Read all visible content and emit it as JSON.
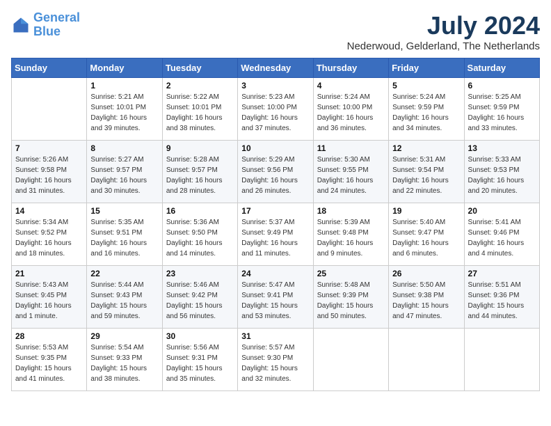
{
  "header": {
    "logo_line1": "General",
    "logo_line2": "Blue",
    "month_year": "July 2024",
    "location": "Nederwoud, Gelderland, The Netherlands"
  },
  "days_of_week": [
    "Sunday",
    "Monday",
    "Tuesday",
    "Wednesday",
    "Thursday",
    "Friday",
    "Saturday"
  ],
  "weeks": [
    [
      {
        "day": "",
        "info": ""
      },
      {
        "day": "1",
        "info": "Sunrise: 5:21 AM\nSunset: 10:01 PM\nDaylight: 16 hours\nand 39 minutes."
      },
      {
        "day": "2",
        "info": "Sunrise: 5:22 AM\nSunset: 10:01 PM\nDaylight: 16 hours\nand 38 minutes."
      },
      {
        "day": "3",
        "info": "Sunrise: 5:23 AM\nSunset: 10:00 PM\nDaylight: 16 hours\nand 37 minutes."
      },
      {
        "day": "4",
        "info": "Sunrise: 5:24 AM\nSunset: 10:00 PM\nDaylight: 16 hours\nand 36 minutes."
      },
      {
        "day": "5",
        "info": "Sunrise: 5:24 AM\nSunset: 9:59 PM\nDaylight: 16 hours\nand 34 minutes."
      },
      {
        "day": "6",
        "info": "Sunrise: 5:25 AM\nSunset: 9:59 PM\nDaylight: 16 hours\nand 33 minutes."
      }
    ],
    [
      {
        "day": "7",
        "info": "Sunrise: 5:26 AM\nSunset: 9:58 PM\nDaylight: 16 hours\nand 31 minutes."
      },
      {
        "day": "8",
        "info": "Sunrise: 5:27 AM\nSunset: 9:57 PM\nDaylight: 16 hours\nand 30 minutes."
      },
      {
        "day": "9",
        "info": "Sunrise: 5:28 AM\nSunset: 9:57 PM\nDaylight: 16 hours\nand 28 minutes."
      },
      {
        "day": "10",
        "info": "Sunrise: 5:29 AM\nSunset: 9:56 PM\nDaylight: 16 hours\nand 26 minutes."
      },
      {
        "day": "11",
        "info": "Sunrise: 5:30 AM\nSunset: 9:55 PM\nDaylight: 16 hours\nand 24 minutes."
      },
      {
        "day": "12",
        "info": "Sunrise: 5:31 AM\nSunset: 9:54 PM\nDaylight: 16 hours\nand 22 minutes."
      },
      {
        "day": "13",
        "info": "Sunrise: 5:33 AM\nSunset: 9:53 PM\nDaylight: 16 hours\nand 20 minutes."
      }
    ],
    [
      {
        "day": "14",
        "info": "Sunrise: 5:34 AM\nSunset: 9:52 PM\nDaylight: 16 hours\nand 18 minutes."
      },
      {
        "day": "15",
        "info": "Sunrise: 5:35 AM\nSunset: 9:51 PM\nDaylight: 16 hours\nand 16 minutes."
      },
      {
        "day": "16",
        "info": "Sunrise: 5:36 AM\nSunset: 9:50 PM\nDaylight: 16 hours\nand 14 minutes."
      },
      {
        "day": "17",
        "info": "Sunrise: 5:37 AM\nSunset: 9:49 PM\nDaylight: 16 hours\nand 11 minutes."
      },
      {
        "day": "18",
        "info": "Sunrise: 5:39 AM\nSunset: 9:48 PM\nDaylight: 16 hours\nand 9 minutes."
      },
      {
        "day": "19",
        "info": "Sunrise: 5:40 AM\nSunset: 9:47 PM\nDaylight: 16 hours\nand 6 minutes."
      },
      {
        "day": "20",
        "info": "Sunrise: 5:41 AM\nSunset: 9:46 PM\nDaylight: 16 hours\nand 4 minutes."
      }
    ],
    [
      {
        "day": "21",
        "info": "Sunrise: 5:43 AM\nSunset: 9:45 PM\nDaylight: 16 hours\nand 1 minute."
      },
      {
        "day": "22",
        "info": "Sunrise: 5:44 AM\nSunset: 9:43 PM\nDaylight: 15 hours\nand 59 minutes."
      },
      {
        "day": "23",
        "info": "Sunrise: 5:46 AM\nSunset: 9:42 PM\nDaylight: 15 hours\nand 56 minutes."
      },
      {
        "day": "24",
        "info": "Sunrise: 5:47 AM\nSunset: 9:41 PM\nDaylight: 15 hours\nand 53 minutes."
      },
      {
        "day": "25",
        "info": "Sunrise: 5:48 AM\nSunset: 9:39 PM\nDaylight: 15 hours\nand 50 minutes."
      },
      {
        "day": "26",
        "info": "Sunrise: 5:50 AM\nSunset: 9:38 PM\nDaylight: 15 hours\nand 47 minutes."
      },
      {
        "day": "27",
        "info": "Sunrise: 5:51 AM\nSunset: 9:36 PM\nDaylight: 15 hours\nand 44 minutes."
      }
    ],
    [
      {
        "day": "28",
        "info": "Sunrise: 5:53 AM\nSunset: 9:35 PM\nDaylight: 15 hours\nand 41 minutes."
      },
      {
        "day": "29",
        "info": "Sunrise: 5:54 AM\nSunset: 9:33 PM\nDaylight: 15 hours\nand 38 minutes."
      },
      {
        "day": "30",
        "info": "Sunrise: 5:56 AM\nSunset: 9:31 PM\nDaylight: 15 hours\nand 35 minutes."
      },
      {
        "day": "31",
        "info": "Sunrise: 5:57 AM\nSunset: 9:30 PM\nDaylight: 15 hours\nand 32 minutes."
      },
      {
        "day": "",
        "info": ""
      },
      {
        "day": "",
        "info": ""
      },
      {
        "day": "",
        "info": ""
      }
    ]
  ]
}
